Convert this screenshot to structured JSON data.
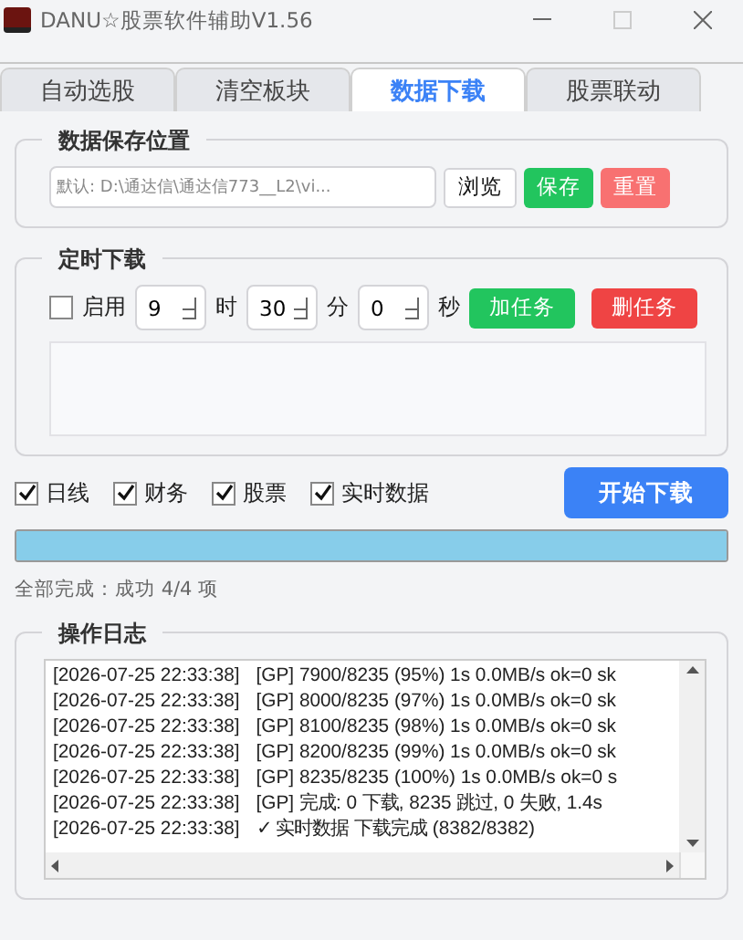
{
  "window": {
    "title": "DANU☆股票软件辅助V1.56"
  },
  "tabs": [
    {
      "label": "自动选股",
      "selected": false
    },
    {
      "label": "清空板块",
      "selected": false
    },
    {
      "label": "数据下载",
      "selected": true
    },
    {
      "label": "股票联动",
      "selected": false
    }
  ],
  "save_location": {
    "title": "数据保存位置",
    "placeholder": "默认: D:\\通达信\\通达信773__L2\\vi...",
    "buttons": [
      {
        "label": "浏览",
        "kind": "plain"
      },
      {
        "label": "保存",
        "kind": "green"
      },
      {
        "label": "重置",
        "kind": "pink"
      }
    ]
  },
  "schedule": {
    "title": "定时下载",
    "enable": {
      "label": "启用",
      "checked": false
    },
    "time": [
      {
        "value": "9",
        "unit": "时"
      },
      {
        "value": "30",
        "unit": "分"
      },
      {
        "value": "0",
        "unit": "秒"
      }
    ],
    "buttons": [
      {
        "label": "加任务",
        "kind": "green"
      },
      {
        "label": "删任务",
        "kind": "red"
      }
    ]
  },
  "options": [
    {
      "label": "日线",
      "checked": true
    },
    {
      "label": "财务",
      "checked": true
    },
    {
      "label": "股票",
      "checked": true
    },
    {
      "label": "实时数据",
      "checked": true
    }
  ],
  "start_button": "开始下载",
  "progress": {
    "level": 1
  },
  "status": "全部完成：成功 4/4 项",
  "log": {
    "title": "操作日志",
    "lines": [
      {
        "time": "[2026-07-25 22:33:38]",
        "message": "[GP] 7900/8235 (95%) 1s 0.0MB/s ok=0 sk"
      },
      {
        "time": "[2026-07-25 22:33:38]",
        "message": "[GP] 8000/8235 (97%) 1s 0.0MB/s ok=0 sk"
      },
      {
        "time": "[2026-07-25 22:33:38]",
        "message": "[GP] 8100/8235 (98%) 1s 0.0MB/s ok=0 sk"
      },
      {
        "time": "[2026-07-25 22:33:38]",
        "message": "[GP] 8200/8235 (99%) 1s 0.0MB/s ok=0 sk"
      },
      {
        "time": "[2026-07-25 22:33:38]",
        "message": "[GP] 8235/8235 (100%) 1s 0.0MB/s ok=0 s"
      },
      {
        "time": "[2026-07-25 22:33:38]",
        "message": "[GP] 完成: 0 下载, 8235 跳过, 0 失败, 1.4s"
      },
      {
        "time": "[2026-07-25 22:33:38]",
        "message": "✓ 实时数据 下载完成 (8382/8382)"
      }
    ]
  }
}
